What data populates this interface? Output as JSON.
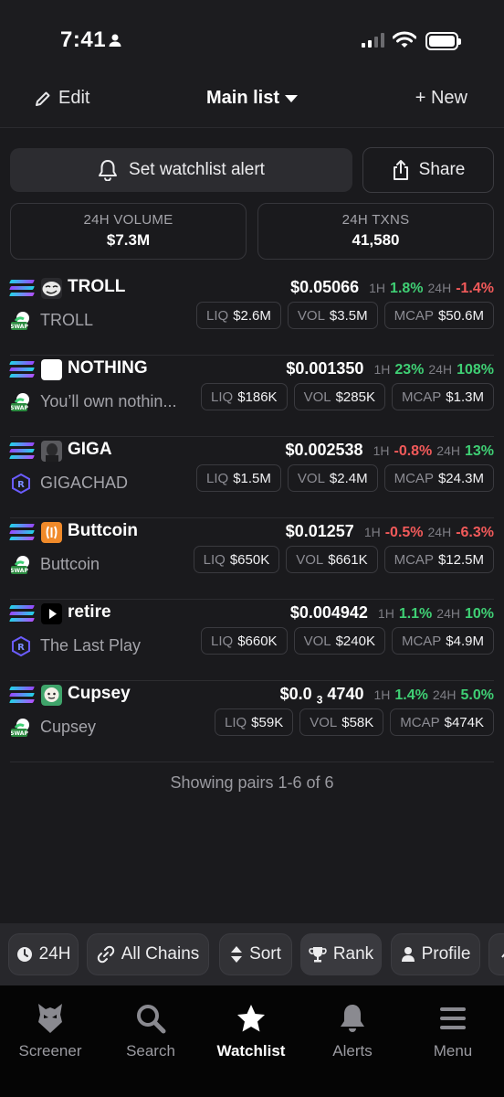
{
  "status_bar": {
    "time": "7:41"
  },
  "header": {
    "edit_label": "Edit",
    "title": "Main list",
    "new_label": "+ New"
  },
  "actions": {
    "alert_label": "Set watchlist alert",
    "share_label": "Share"
  },
  "stats": {
    "volume_label": "24H VOLUME",
    "volume_value": "$7.3M",
    "txns_label": "24H TXNS",
    "txns_value": "41,580"
  },
  "pairs": [
    {
      "name": "TROLL",
      "sub": "TROLL",
      "price": "$0.05066",
      "h1_label": "1H",
      "h1": "1.8%",
      "h24_label": "24H",
      "h24": "-1.4%",
      "liq_label": "LIQ",
      "liq": "$2.6M",
      "vol_label": "VOL",
      "vol": "$3.5M",
      "mcap_label": "MCAP",
      "mcap": "$50.6M"
    },
    {
      "name": "NOTHING",
      "sub": "You’ll own nothin...",
      "price": "$0.001350",
      "h1_label": "1H",
      "h1": "23%",
      "h24_label": "24H",
      "h24": "108%",
      "liq_label": "LIQ",
      "liq": "$186K",
      "vol_label": "VOL",
      "vol": "$285K",
      "mcap_label": "MCAP",
      "mcap": "$1.3M"
    },
    {
      "name": "GIGA",
      "sub": "GIGACHAD",
      "price": "$0.002538",
      "h1_label": "1H",
      "h1": "-0.8%",
      "h24_label": "24H",
      "h24": "13%",
      "liq_label": "LIQ",
      "liq": "$1.5M",
      "vol_label": "VOL",
      "vol": "$2.4M",
      "mcap_label": "MCAP",
      "mcap": "$24.3M"
    },
    {
      "name": "Buttcoin",
      "sub": "Buttcoin",
      "price": "$0.01257",
      "h1_label": "1H",
      "h1": "-0.5%",
      "h24_label": "24H",
      "h24": "-6.3%",
      "liq_label": "LIQ",
      "liq": "$650K",
      "vol_label": "VOL",
      "vol": "$661K",
      "mcap_label": "MCAP",
      "mcap": "$12.5M"
    },
    {
      "name": "retire",
      "sub": "The Last Play",
      "price": "$0.004942",
      "h1_label": "1H",
      "h1": "1.1%",
      "h24_label": "24H",
      "h24": "10%",
      "liq_label": "LIQ",
      "liq": "$660K",
      "vol_label": "VOL",
      "vol": "$240K",
      "mcap_label": "MCAP",
      "mcap": "$4.9M"
    },
    {
      "name": "Cupsey",
      "sub": "Cupsey",
      "price_prefix": "$0.0",
      "price_sub": "3",
      "price_suffix": "4740",
      "h1_label": "1H",
      "h1": "1.4%",
      "h24_label": "24H",
      "h24": "5.0%",
      "liq_label": "LIQ",
      "liq": "$59K",
      "vol_label": "VOL",
      "vol": "$58K",
      "mcap_label": "MCAP",
      "mcap": "$474K"
    }
  ],
  "footer_text": "Showing pairs 1-6 of 6",
  "filters": {
    "time": "24H",
    "chains": "All Chains",
    "sort": "Sort",
    "rank": "Rank",
    "profile": "Profile"
  },
  "nav": {
    "screener": "Screener",
    "search": "Search",
    "watchlist": "Watchlist",
    "alerts": "Alerts",
    "menu": "Menu"
  },
  "colors": {
    "up": "#3fcf74",
    "down": "#f25a5a",
    "background": "#1a1a1d"
  }
}
